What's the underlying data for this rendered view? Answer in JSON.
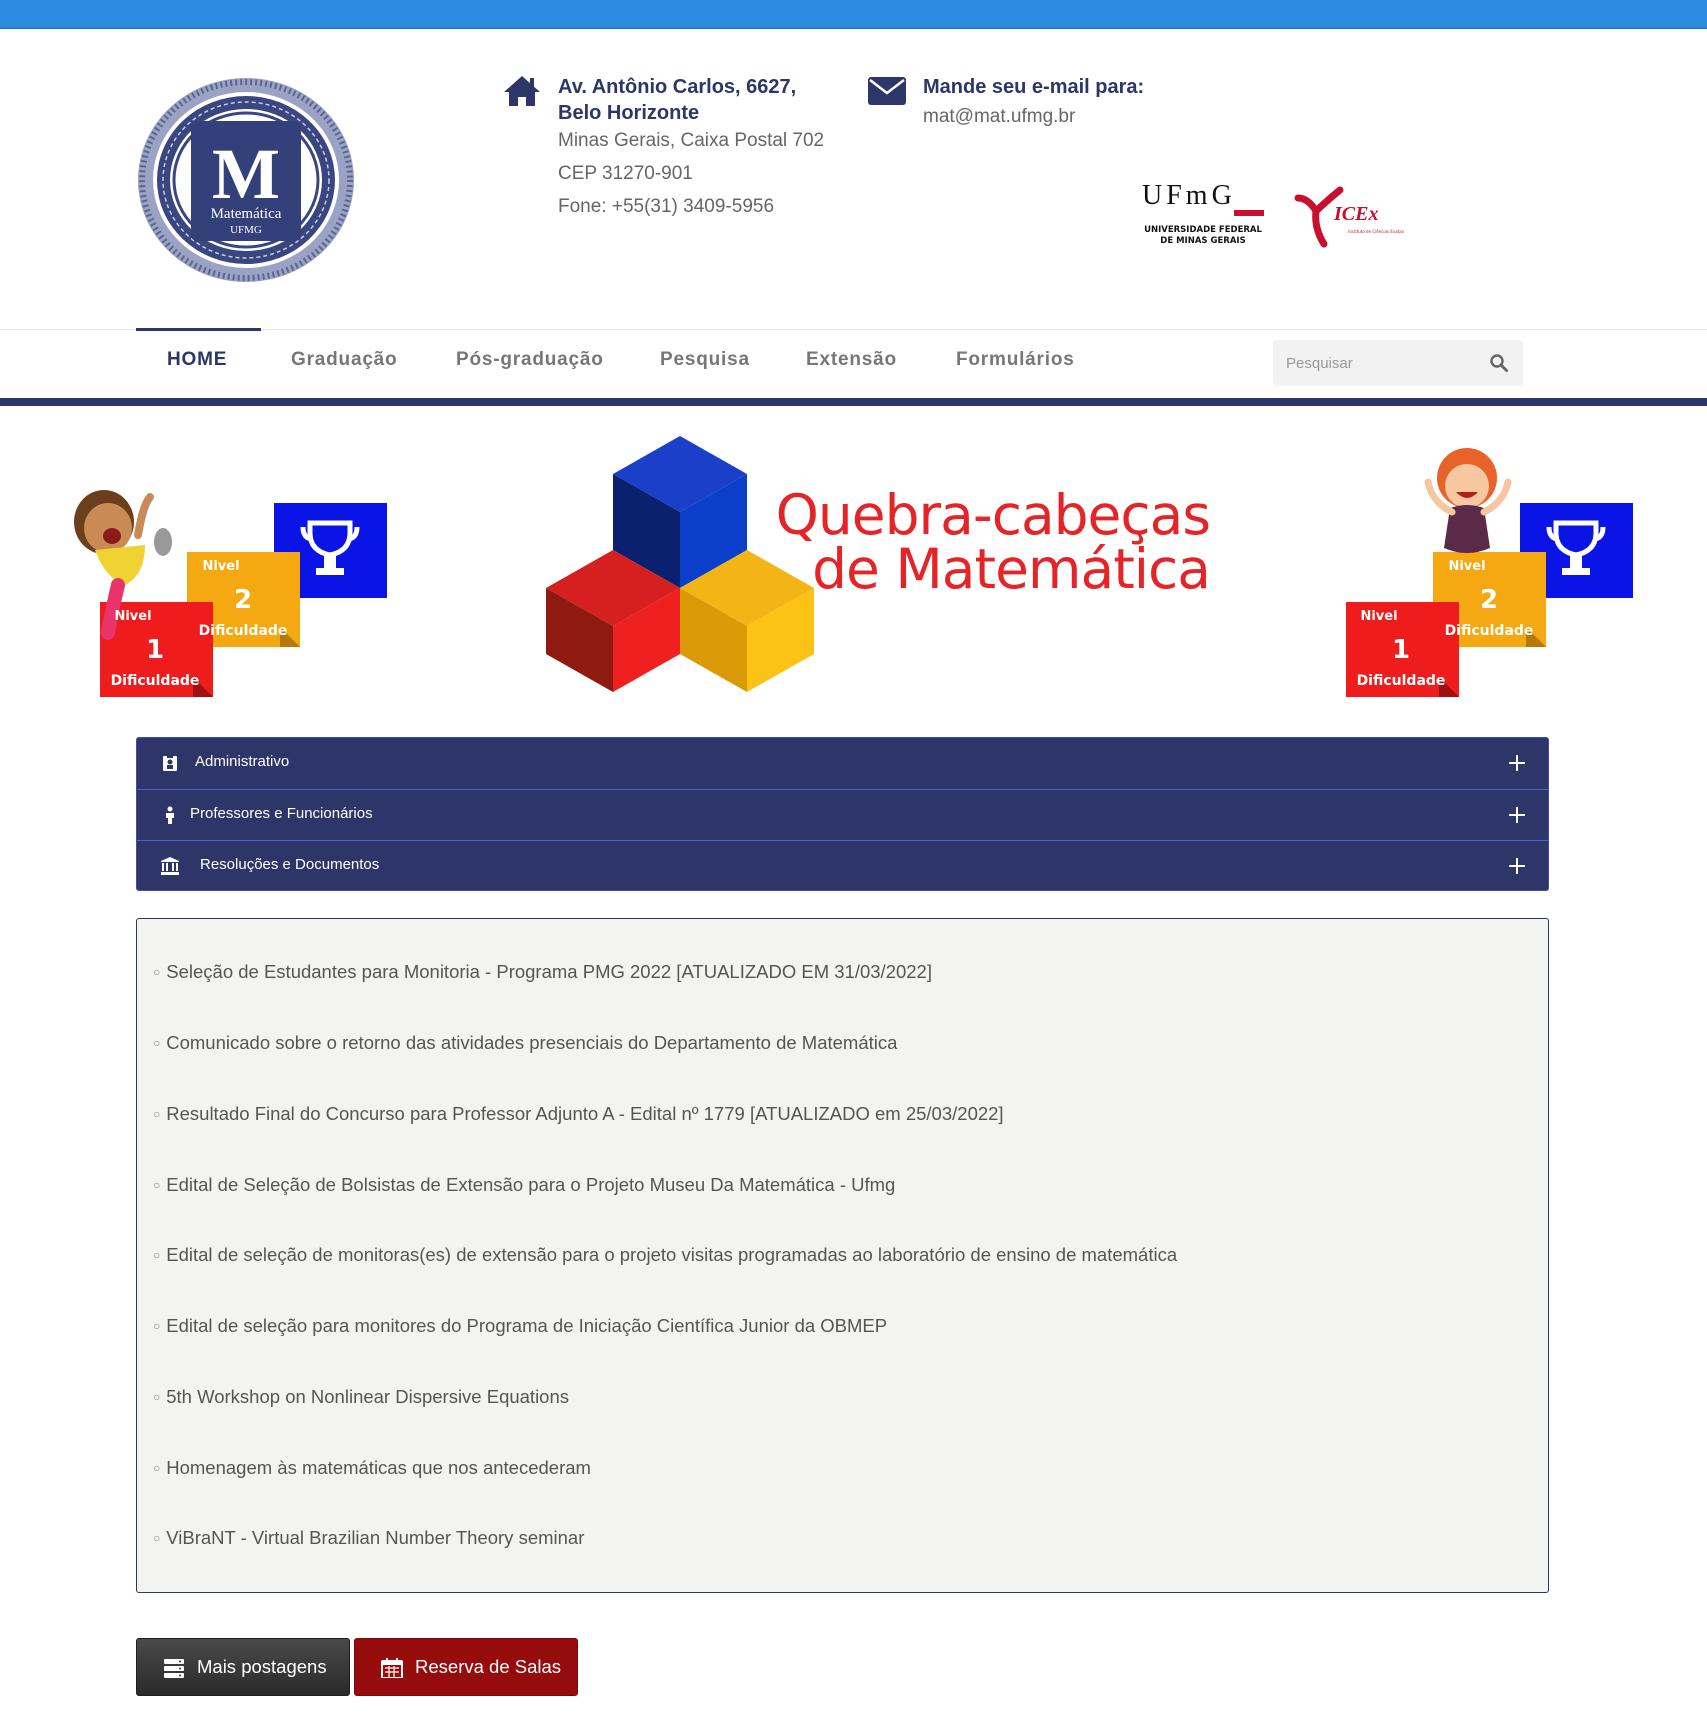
{
  "header": {
    "logo": {
      "big_letter": "M",
      "line1": "Matemática",
      "line2": "UFMG"
    },
    "address": {
      "icon": "home-icon",
      "title": "Av. Antônio Carlos, 6627, Belo Horizonte",
      "lines": [
        "Minas Gerais, Caixa Postal 702",
        "CEP 31270-901",
        "Fone: +55(31) 3409-5956"
      ]
    },
    "email": {
      "icon": "envelope-icon",
      "title": "Mande seu e-mail para:",
      "address": "mat@mat.ufmg.br"
    },
    "partners": {
      "ufmg": {
        "wordmark": "UFmG",
        "line1": "UNIVERSIDADE FEDERAL",
        "line2": "DE MINAS GERAIS"
      },
      "icex": {
        "wordmark": "ICEx",
        "subtitle": "Instituto de Ciências Exatas"
      }
    }
  },
  "nav": {
    "items": [
      "HOME",
      "Graduação",
      "Pós-graduação",
      "Pesquisa",
      "Extensão",
      "Formulários"
    ],
    "active": "HOME",
    "search_placeholder": "Pesquisar"
  },
  "banner": {
    "title_line1": "Quebra-cabeças",
    "title_line2": "de Matemática",
    "podium": {
      "level_word": "Nivel",
      "difficulty_word": "Dificuldade",
      "level1": "1",
      "level2": "2"
    }
  },
  "accordion": [
    {
      "label": "Administrativo",
      "icon": "id-badge-icon"
    },
    {
      "label": "Professores e Funcionários",
      "icon": "person-icon"
    },
    {
      "label": "Resoluções e Documentos",
      "icon": "institution-icon"
    }
  ],
  "news": [
    "Seleção de Estudantes para Monitoria - Programa PMG 2022 [ATUALIZADO EM 31/03/2022]",
    "Comunicado sobre o retorno das atividades presenciais do Departamento de Matemática",
    "Resultado Final do Concurso para Professor Adjunto A - Edital nº 1779 [ATUALIZADO em 25/03/2022]",
    "Edital de Seleção de Bolsistas de Extensão para o Projeto Museu Da Matemática - Ufmg",
    "Edital de seleção de monitoras(es) de extensão para o projeto visitas programadas ao laboratório de ensino de matemática",
    "Edital de seleção para monitores do Programa de Iniciação Científica Junior da OBMEP",
    "5th Workshop on Nonlinear Dispersive Equations",
    "Homenagem às matemáticas que nos antecederam",
    "ViBraNT - Virtual Brazilian Number Theory seminar"
  ],
  "buttons": {
    "more_posts": "Mais postagens",
    "room_booking": "Reserva de Salas"
  },
  "colors": {
    "top_strip": "#2c8be0",
    "navy": "#2d3668",
    "accordion_bg": "#2e3568",
    "news_bg": "#f3f3ef",
    "booking_red": "#960c0c",
    "banner_red": "#e52427"
  }
}
